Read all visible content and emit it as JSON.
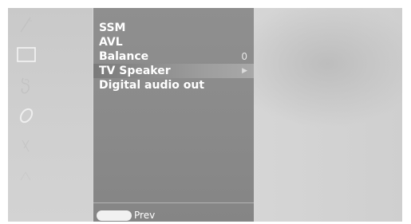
{
  "menu": {
    "items": [
      {
        "label": "SSM",
        "value": "",
        "has_submenu": false,
        "selected": false
      },
      {
        "label": "AVL",
        "value": "",
        "has_submenu": false,
        "selected": false
      },
      {
        "label": "Balance",
        "value": "0",
        "has_submenu": false,
        "selected": false
      },
      {
        "label": "TV Speaker",
        "value": "",
        "has_submenu": true,
        "selected": true
      },
      {
        "label": "Digital audio out",
        "value": "",
        "has_submenu": false,
        "selected": false
      }
    ],
    "selected_index": 3
  },
  "footer": {
    "prev_label": "Prev"
  },
  "side_icons": [
    "picture-icon",
    "screen-icon",
    "sound-icon",
    "time-icon",
    "lock-icon",
    "option-icon"
  ],
  "colors": {
    "menu_panel": "#8a8a8a",
    "background": "#d6d6d6",
    "text": "#ffffff"
  }
}
